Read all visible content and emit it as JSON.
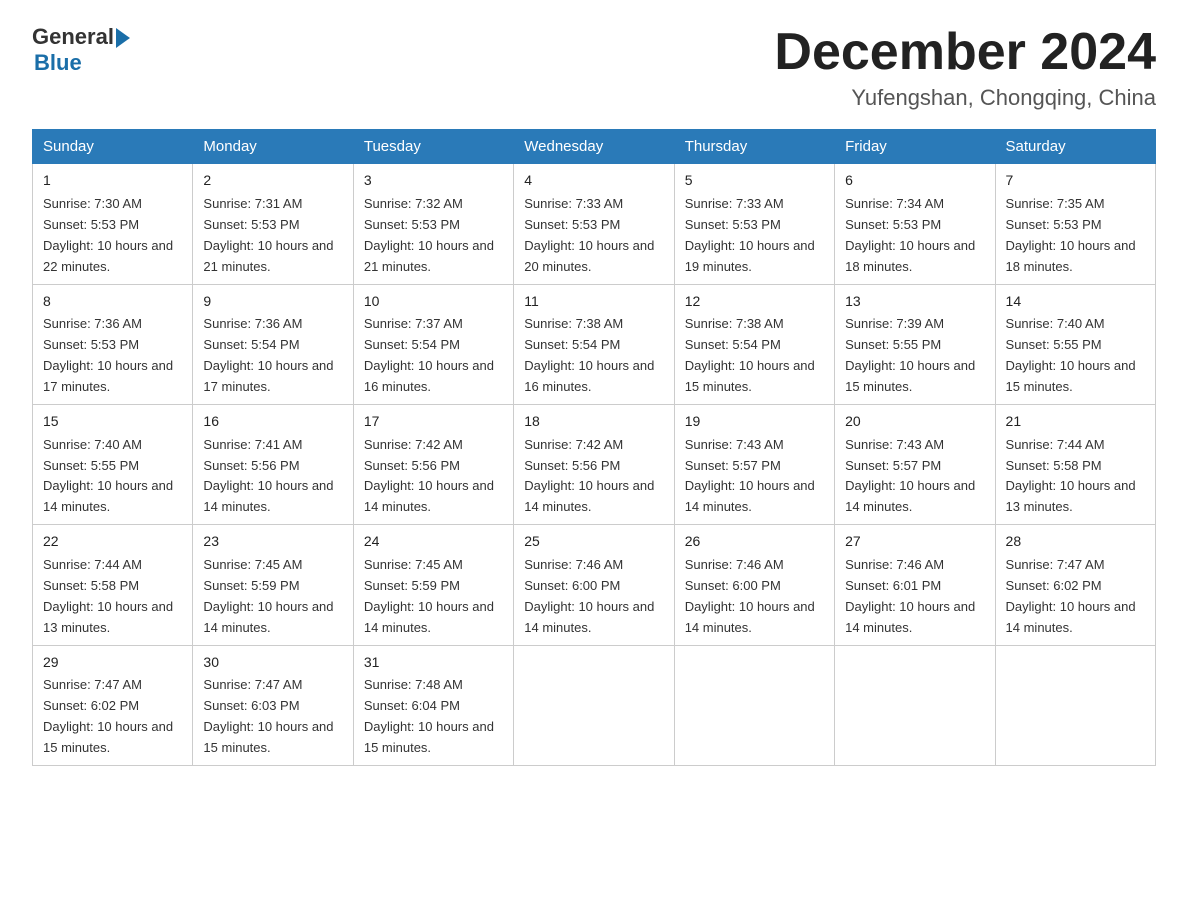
{
  "logo": {
    "general": "General",
    "blue": "Blue"
  },
  "title": "December 2024",
  "subtitle": "Yufengshan, Chongqing, China",
  "days_of_week": [
    "Sunday",
    "Monday",
    "Tuesday",
    "Wednesday",
    "Thursday",
    "Friday",
    "Saturday"
  ],
  "weeks": [
    [
      {
        "day": "1",
        "sunrise": "7:30 AM",
        "sunset": "5:53 PM",
        "daylight": "10 hours and 22 minutes."
      },
      {
        "day": "2",
        "sunrise": "7:31 AM",
        "sunset": "5:53 PM",
        "daylight": "10 hours and 21 minutes."
      },
      {
        "day": "3",
        "sunrise": "7:32 AM",
        "sunset": "5:53 PM",
        "daylight": "10 hours and 21 minutes."
      },
      {
        "day": "4",
        "sunrise": "7:33 AM",
        "sunset": "5:53 PM",
        "daylight": "10 hours and 20 minutes."
      },
      {
        "day": "5",
        "sunrise": "7:33 AM",
        "sunset": "5:53 PM",
        "daylight": "10 hours and 19 minutes."
      },
      {
        "day": "6",
        "sunrise": "7:34 AM",
        "sunset": "5:53 PM",
        "daylight": "10 hours and 18 minutes."
      },
      {
        "day": "7",
        "sunrise": "7:35 AM",
        "sunset": "5:53 PM",
        "daylight": "10 hours and 18 minutes."
      }
    ],
    [
      {
        "day": "8",
        "sunrise": "7:36 AM",
        "sunset": "5:53 PM",
        "daylight": "10 hours and 17 minutes."
      },
      {
        "day": "9",
        "sunrise": "7:36 AM",
        "sunset": "5:54 PM",
        "daylight": "10 hours and 17 minutes."
      },
      {
        "day": "10",
        "sunrise": "7:37 AM",
        "sunset": "5:54 PM",
        "daylight": "10 hours and 16 minutes."
      },
      {
        "day": "11",
        "sunrise": "7:38 AM",
        "sunset": "5:54 PM",
        "daylight": "10 hours and 16 minutes."
      },
      {
        "day": "12",
        "sunrise": "7:38 AM",
        "sunset": "5:54 PM",
        "daylight": "10 hours and 15 minutes."
      },
      {
        "day": "13",
        "sunrise": "7:39 AM",
        "sunset": "5:55 PM",
        "daylight": "10 hours and 15 minutes."
      },
      {
        "day": "14",
        "sunrise": "7:40 AM",
        "sunset": "5:55 PM",
        "daylight": "10 hours and 15 minutes."
      }
    ],
    [
      {
        "day": "15",
        "sunrise": "7:40 AM",
        "sunset": "5:55 PM",
        "daylight": "10 hours and 14 minutes."
      },
      {
        "day": "16",
        "sunrise": "7:41 AM",
        "sunset": "5:56 PM",
        "daylight": "10 hours and 14 minutes."
      },
      {
        "day": "17",
        "sunrise": "7:42 AM",
        "sunset": "5:56 PM",
        "daylight": "10 hours and 14 minutes."
      },
      {
        "day": "18",
        "sunrise": "7:42 AM",
        "sunset": "5:56 PM",
        "daylight": "10 hours and 14 minutes."
      },
      {
        "day": "19",
        "sunrise": "7:43 AM",
        "sunset": "5:57 PM",
        "daylight": "10 hours and 14 minutes."
      },
      {
        "day": "20",
        "sunrise": "7:43 AM",
        "sunset": "5:57 PM",
        "daylight": "10 hours and 14 minutes."
      },
      {
        "day": "21",
        "sunrise": "7:44 AM",
        "sunset": "5:58 PM",
        "daylight": "10 hours and 13 minutes."
      }
    ],
    [
      {
        "day": "22",
        "sunrise": "7:44 AM",
        "sunset": "5:58 PM",
        "daylight": "10 hours and 13 minutes."
      },
      {
        "day": "23",
        "sunrise": "7:45 AM",
        "sunset": "5:59 PM",
        "daylight": "10 hours and 14 minutes."
      },
      {
        "day": "24",
        "sunrise": "7:45 AM",
        "sunset": "5:59 PM",
        "daylight": "10 hours and 14 minutes."
      },
      {
        "day": "25",
        "sunrise": "7:46 AM",
        "sunset": "6:00 PM",
        "daylight": "10 hours and 14 minutes."
      },
      {
        "day": "26",
        "sunrise": "7:46 AM",
        "sunset": "6:00 PM",
        "daylight": "10 hours and 14 minutes."
      },
      {
        "day": "27",
        "sunrise": "7:46 AM",
        "sunset": "6:01 PM",
        "daylight": "10 hours and 14 minutes."
      },
      {
        "day": "28",
        "sunrise": "7:47 AM",
        "sunset": "6:02 PM",
        "daylight": "10 hours and 14 minutes."
      }
    ],
    [
      {
        "day": "29",
        "sunrise": "7:47 AM",
        "sunset": "6:02 PM",
        "daylight": "10 hours and 15 minutes."
      },
      {
        "day": "30",
        "sunrise": "7:47 AM",
        "sunset": "6:03 PM",
        "daylight": "10 hours and 15 minutes."
      },
      {
        "day": "31",
        "sunrise": "7:48 AM",
        "sunset": "6:04 PM",
        "daylight": "10 hours and 15 minutes."
      },
      null,
      null,
      null,
      null
    ]
  ],
  "labels": {
    "sunrise_prefix": "Sunrise: ",
    "sunset_prefix": "Sunset: ",
    "daylight_prefix": "Daylight: "
  }
}
